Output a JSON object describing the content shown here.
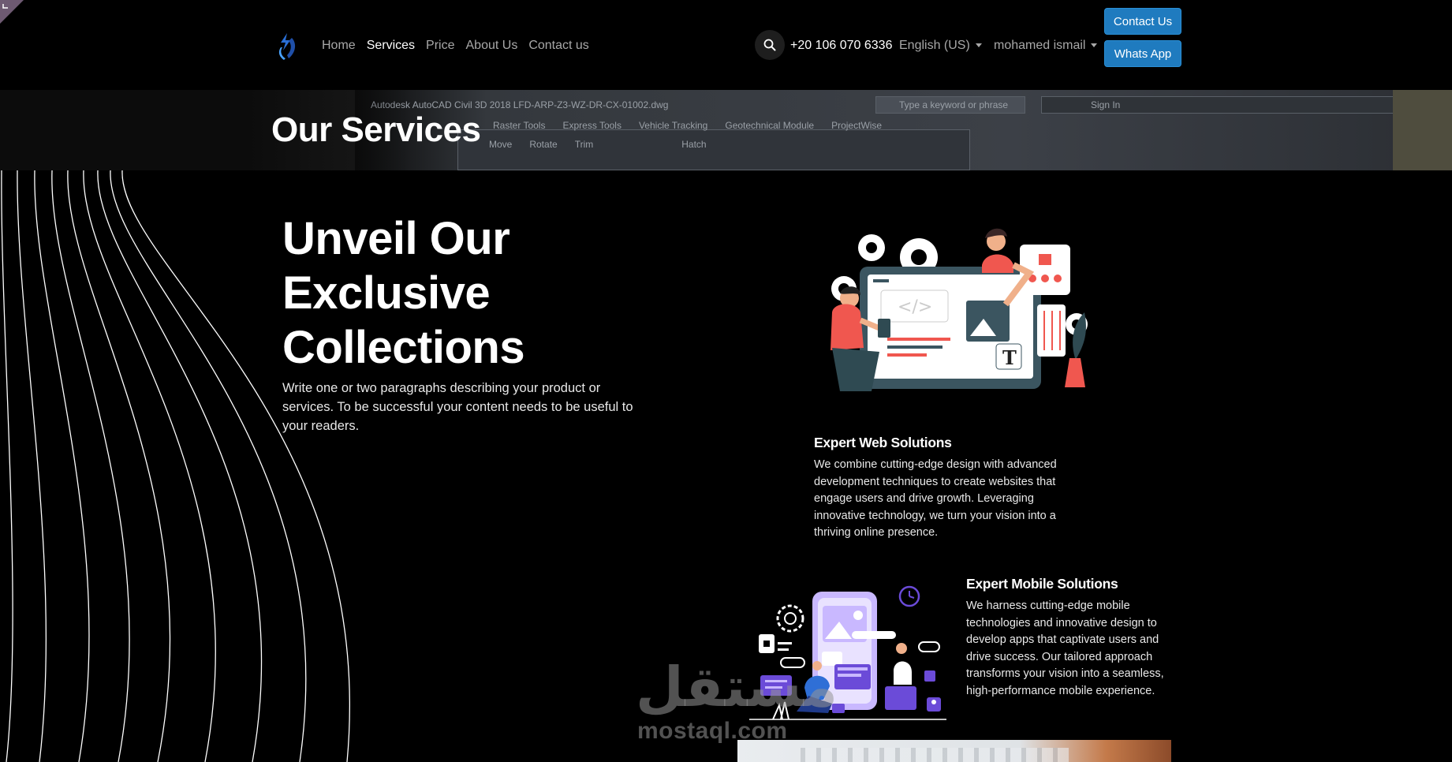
{
  "nav": {
    "items": [
      "Home",
      "Services",
      "Price",
      "About Us",
      "Contact us"
    ],
    "active": "Services"
  },
  "header": {
    "phone": "+20 106 070 6336",
    "language": "English (US)",
    "user": "mohamed ismail",
    "contact_button": "Contact Us",
    "whatsapp_button": "Whats App"
  },
  "banner": {
    "title": "Our Services",
    "bg_title": "Autodesk AutoCAD Civil 3D 2018   LFD-ARP-Z3-WZ-DR-CX-01002.dwg",
    "bg_menu": [
      "Raster Tools",
      "Express Tools",
      "Vehicle Tracking",
      "Geotechnical Module",
      "ProjectWise"
    ],
    "bg_tools": [
      "Move",
      "Rotate",
      "Trim",
      "Hatch"
    ],
    "bg_search": "Type a keyword or phrase",
    "bg_signin": "Sign In"
  },
  "hero": {
    "title_lines": [
      "Unveil Our",
      "Exclusive",
      "Collections"
    ],
    "text": "Write one or two paragraphs describing your product or services. To be successful your content needs to be useful to your readers."
  },
  "services": [
    {
      "title": "Expert Web Solutions",
      "text": "We combine cutting-edge design with advanced development techniques to create websites that engage users and drive growth. Leveraging innovative technology, we turn your vision into a thriving online presence."
    },
    {
      "title": "Expert Mobile Solutions",
      "text": "We harness cutting-edge mobile technologies and innovative design to develop apps that captivate users and drive success. Our tailored approach transforms your vision into a seamless, high-performance mobile experience."
    }
  ],
  "watermark": {
    "arabic": "مستقل",
    "latin": "mostaql.com"
  },
  "colors": {
    "accent_button": "#1f7bbf",
    "illustration_red": "#f0574f",
    "illustration_purple": "#6b4bd8",
    "illustration_dark": "#2f4a52"
  },
  "icons": [
    "search-icon",
    "logo-icon",
    "chevron-down-icon"
  ]
}
